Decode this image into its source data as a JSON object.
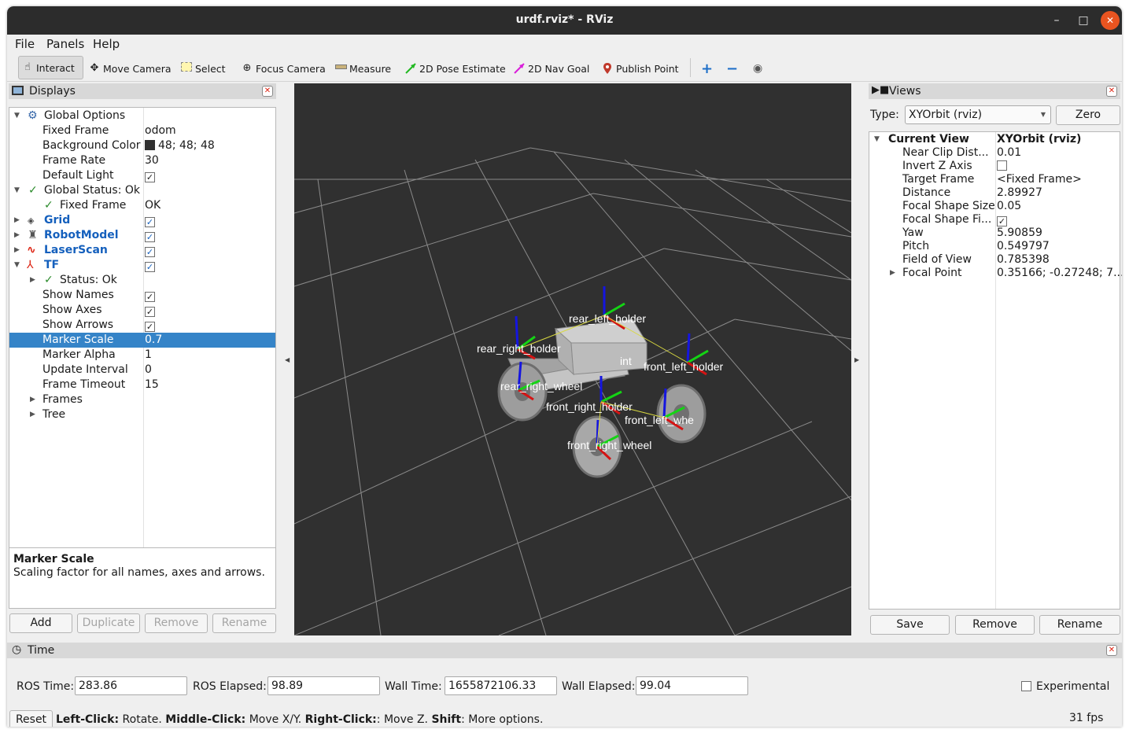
{
  "window": {
    "title": "urdf.rviz* - RViz",
    "minimize": "–",
    "maximize": "□",
    "close": "✕"
  },
  "menu": {
    "file": "File",
    "panels": "Panels",
    "help": "Help"
  },
  "toolbar": {
    "interact": "Interact",
    "move_camera": "Move Camera",
    "select": "Select",
    "focus_camera": "Focus Camera",
    "measure": "Measure",
    "pose_estimate": "2D Pose Estimate",
    "nav_goal": "2D Nav Goal",
    "publish_point": "Publish Point",
    "colors": {
      "pose": "#22b922",
      "nav": "#d91ed9",
      "publish": "#c0392b",
      "plus": "#1e6fc8"
    }
  },
  "displays": {
    "title": "Displays",
    "rows": [
      {
        "label": "Global Options",
        "value": ""
      },
      {
        "label": "Fixed Frame",
        "value": "odom"
      },
      {
        "label": "Background Color",
        "value": "48; 48; 48"
      },
      {
        "label": "Frame Rate",
        "value": "30"
      },
      {
        "label": "Default Light",
        "value": ""
      },
      {
        "label": "Global Status: Ok",
        "value": ""
      },
      {
        "label": "Fixed Frame",
        "value": "OK"
      },
      {
        "label": "Grid",
        "value": ""
      },
      {
        "label": "RobotModel",
        "value": ""
      },
      {
        "label": "LaserScan",
        "value": ""
      },
      {
        "label": "TF",
        "value": ""
      },
      {
        "label": "Status: Ok",
        "value": ""
      },
      {
        "label": "Show Names",
        "value": ""
      },
      {
        "label": "Show Axes",
        "value": ""
      },
      {
        "label": "Show Arrows",
        "value": ""
      },
      {
        "label": "Marker Scale",
        "value": "0.7"
      },
      {
        "label": "Marker Alpha",
        "value": "1"
      },
      {
        "label": "Update Interval",
        "value": "0"
      },
      {
        "label": "Frame Timeout",
        "value": "15"
      },
      {
        "label": "Frames",
        "value": ""
      },
      {
        "label": "Tree",
        "value": ""
      }
    ],
    "description_title": "Marker Scale",
    "description_text": "Scaling factor for all names, axes and arrows.",
    "buttons": {
      "add": "Add",
      "duplicate": "Duplicate",
      "remove": "Remove",
      "rename": "Rename"
    }
  },
  "viewport_labels": {
    "rear_right_holder": "rear_right_holder",
    "rear_left_holder": "rear_left_holder",
    "base_joint": "int",
    "front_left_holder": "front_left_holder",
    "rear_right_wheel": "rear_right_wheel",
    "front_right_holder": "front_right_holder",
    "front_left_wheel": "front_left_whe",
    "front_right_wheel": "front_right_wheel"
  },
  "views": {
    "title": "Views",
    "type_label": "Type:",
    "type_value": "XYOrbit (rviz)",
    "zero": "Zero",
    "rows": [
      {
        "label": "Current View",
        "value": "XYOrbit (rviz)"
      },
      {
        "label": "Near Clip Dist...",
        "value": "0.01"
      },
      {
        "label": "Invert Z Axis",
        "value": ""
      },
      {
        "label": "Target Frame",
        "value": "<Fixed Frame>"
      },
      {
        "label": "Distance",
        "value": "2.89927"
      },
      {
        "label": "Focal Shape Size",
        "value": "0.05"
      },
      {
        "label": "Focal Shape Fi...",
        "value": ""
      },
      {
        "label": "Yaw",
        "value": "5.90859"
      },
      {
        "label": "Pitch",
        "value": "0.549797"
      },
      {
        "label": "Field of View",
        "value": "0.785398"
      },
      {
        "label": "Focal Point",
        "value": "0.35166; -0.27248; 7..."
      }
    ],
    "buttons": {
      "save": "Save",
      "remove": "Remove",
      "rename": "Rename"
    }
  },
  "time": {
    "title": "Time",
    "ros_time_label": "ROS Time:",
    "ros_time": "283.86",
    "ros_elapsed_label": "ROS Elapsed:",
    "ros_elapsed": "98.89",
    "wall_time_label": "Wall Time:",
    "wall_time": "1655872106.33",
    "wall_elapsed_label": "Wall Elapsed:",
    "wall_elapsed": "99.04",
    "experimental": "Experimental",
    "reset": "Reset",
    "hint_parts": [
      "Left-Click:",
      " Rotate. ",
      "Middle-Click:",
      " Move X/Y. ",
      "Right-Click:",
      ": Move Z. ",
      "Shift",
      ": More options."
    ],
    "fps": "31 fps"
  }
}
